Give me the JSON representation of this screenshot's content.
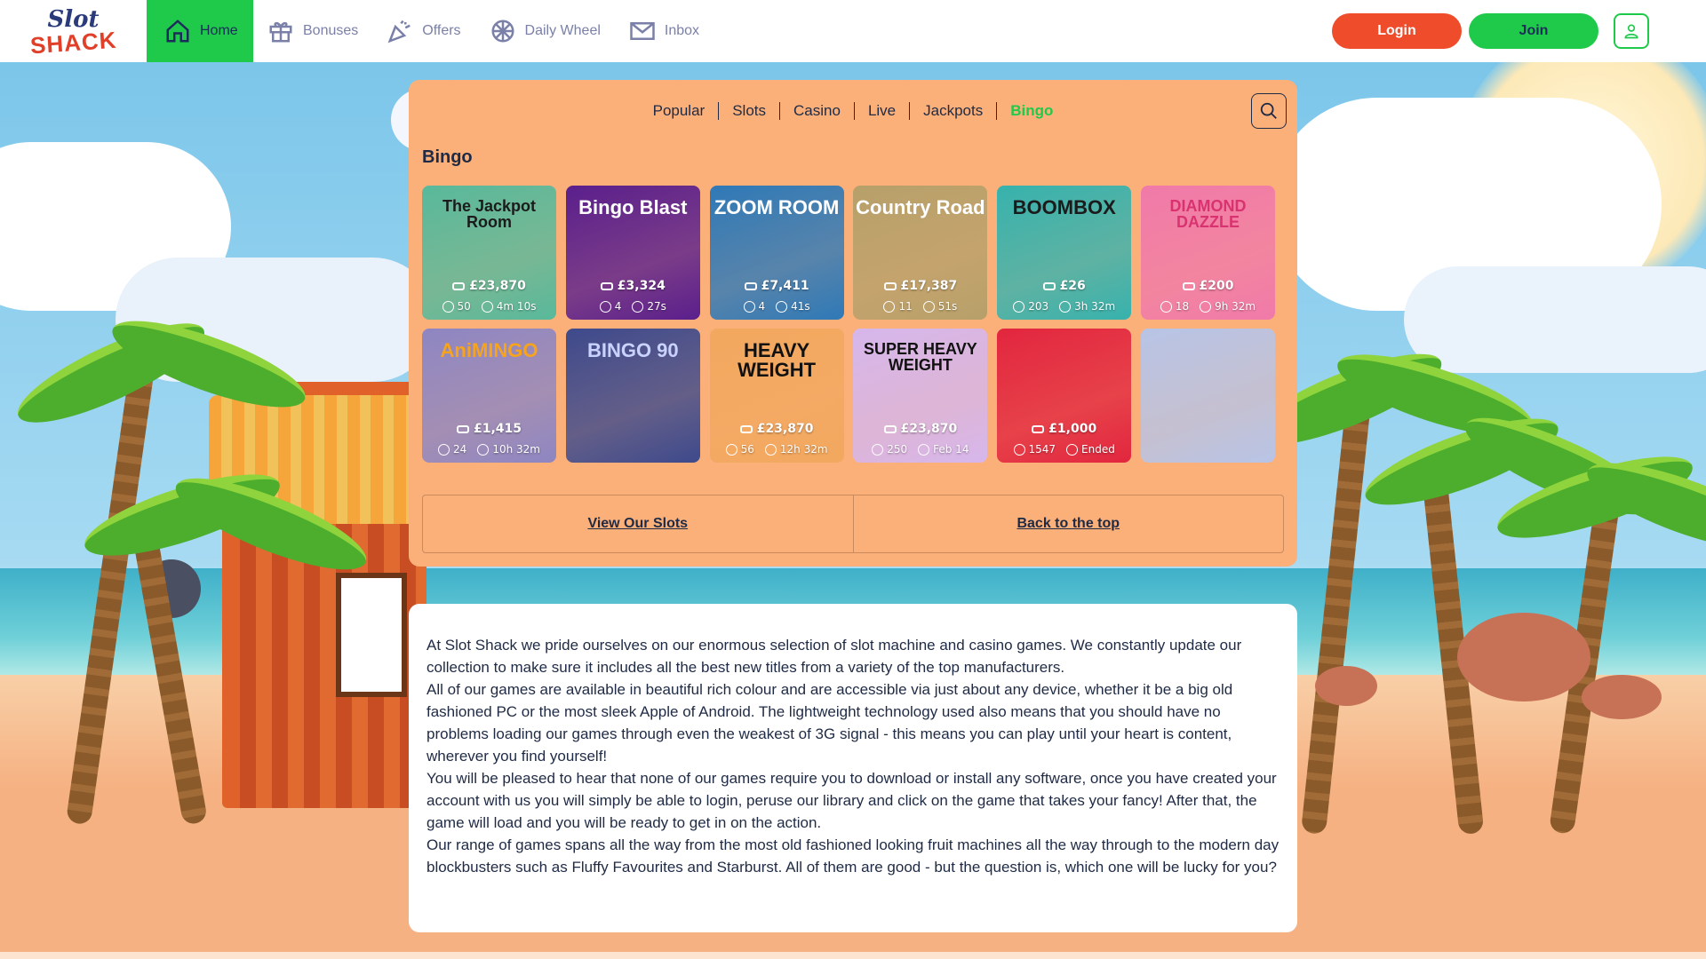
{
  "header": {
    "logo_top": "Slot",
    "logo_bottom": "SHACK",
    "nav": [
      {
        "label": "Home",
        "icon": "home-icon",
        "active": true
      },
      {
        "label": "Bonuses",
        "icon": "gift-icon"
      },
      {
        "label": "Offers",
        "icon": "party-popper-icon"
      },
      {
        "label": "Daily Wheel",
        "icon": "wheel-icon"
      },
      {
        "label": "Inbox",
        "icon": "envelope-icon"
      }
    ],
    "login_label": "Login",
    "join_label": "Join",
    "accent": "#1fca4b",
    "login_color": "#ef4c2c"
  },
  "categories": [
    {
      "label": "Popular"
    },
    {
      "label": "Slots"
    },
    {
      "label": "Casino"
    },
    {
      "label": "Live"
    },
    {
      "label": "Jackpots"
    },
    {
      "label": "Bingo",
      "active": true
    }
  ],
  "section_title": "Bingo",
  "games": [
    {
      "name": "The Jackpot Room",
      "jackpot": "£23,870",
      "players": "50",
      "time": "4m 10s",
      "bg": "#58b99b",
      "color": "#1b1b1b"
    },
    {
      "name": "Bingo Blast",
      "jackpot": "£3,324",
      "players": "4",
      "time": "27s",
      "bg": "#5a1f8c",
      "color": "#ffffff"
    },
    {
      "name": "ZOOM ROOM",
      "jackpot": "£7,411",
      "players": "4",
      "time": "41s",
      "bg": "#2f79b7",
      "color": "#ffffff"
    },
    {
      "name": "Country Road",
      "jackpot": "£17,387",
      "players": "11",
      "time": "51s",
      "bg": "#b7a06a",
      "color": "#ffffff"
    },
    {
      "name": "BOOMBOX",
      "jackpot": "£26",
      "players": "203",
      "time": "3h 32m",
      "bg": "#37b2ad",
      "color": "#1b1b1b"
    },
    {
      "name": "DIAMOND DAZZLE",
      "jackpot": "£200",
      "players": "18",
      "time": "9h 32m",
      "bg": "#f07aa9",
      "color": "#d9336f"
    },
    {
      "name": "AniMINGO",
      "jackpot": "£1,415",
      "players": "24",
      "time": "10h 32m",
      "bg": "#8e86c2",
      "color": "#f7a41a"
    },
    {
      "name": "BINGO 90",
      "jackpot": "",
      "players": "",
      "time": "",
      "bg": "#3e4a8c",
      "color": "#c9d3ff"
    },
    {
      "name": "HEAVY WEIGHT",
      "jackpot": "£23,870",
      "players": "56",
      "time": "12h 32m",
      "bg": "#f2a85e",
      "color": "#111111"
    },
    {
      "name": "SUPER HEAVY WEIGHT",
      "jackpot": "£23,870",
      "players": "250",
      "time": "Feb 14",
      "bg": "#d6b6ec",
      "color": "#111111"
    },
    {
      "name": "",
      "jackpot": "£1,000",
      "players": "1547",
      "time": "Ended",
      "bg": "#e2263e",
      "color": "#ffffff"
    },
    {
      "name": "",
      "jackpot": "",
      "players": "",
      "time": "",
      "bg": "#b8c4e6",
      "color": "#ffffff"
    }
  ],
  "links": {
    "view_slots": "View Our Slots",
    "back_top": "Back to the top"
  },
  "info": [
    "At Slot Shack we pride ourselves on our enormous selection of slot machine and casino games. We constantly update our collection to make sure it includes all the best new titles from a variety of the top manufacturers.",
    "All of our games are available in beautiful rich colour and are accessible via just about any device, whether it be a big old fashioned PC or the most sleek Apple of Android. The lightweight technology used also means that you should have no problems loading our games through even the weakest of 3G signal - this means you can play until your heart is content, wherever you find yourself!",
    "You will be pleased to hear that none of our games require you to download or install any software, once you have created your account with us you will simply be able to login, peruse our library and click on the game that takes your fancy! After that, the game will load and you will be ready to get in on the action.",
    "Our range of games spans all the way from the most old fashioned looking fruit machines all the way through to the modern day blockbusters such as Fluffy Favourites and Starburst. All of them are good - but the question is, which one will be lucky for you?"
  ]
}
